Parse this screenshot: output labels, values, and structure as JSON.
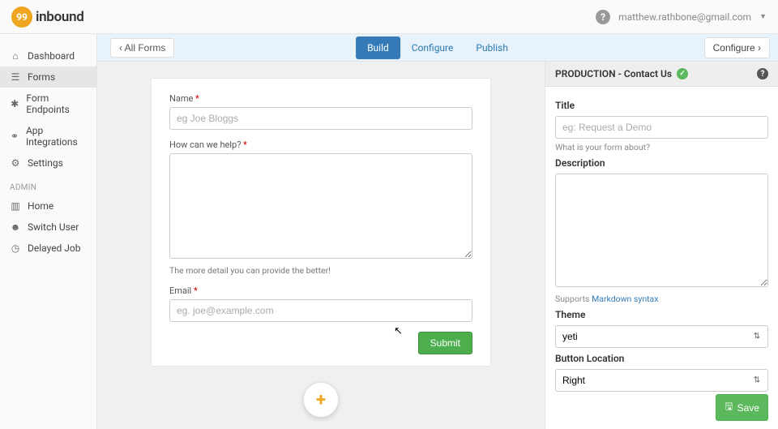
{
  "brand": {
    "badge": "99",
    "name": "inbound"
  },
  "user": {
    "email": "matthew.rathbone@gmail.com"
  },
  "sidebar": {
    "items": [
      {
        "icon": "home",
        "label": "Dashboard"
      },
      {
        "icon": "list",
        "label": "Forms"
      },
      {
        "icon": "code",
        "label": "Form Endpoints"
      },
      {
        "icon": "plug",
        "label": "App Integrations"
      },
      {
        "icon": "gear",
        "label": "Settings"
      }
    ],
    "admin_heading": "ADMIN",
    "admin_items": [
      {
        "icon": "chart",
        "label": "Home"
      },
      {
        "icon": "user",
        "label": "Switch User"
      },
      {
        "icon": "clock",
        "label": "Delayed Job"
      }
    ]
  },
  "tabbar": {
    "all_forms": "All Forms",
    "tabs": [
      "Build",
      "Configure",
      "Publish"
    ],
    "configure_btn": "Configure"
  },
  "form": {
    "fields": [
      {
        "label": "Name",
        "required": true,
        "placeholder": "eg Joe Bloggs",
        "type": "text"
      },
      {
        "label": "How can we help?",
        "required": true,
        "placeholder": "",
        "type": "textarea",
        "help": "The more detail you can provide the better!"
      },
      {
        "label": "Email",
        "required": true,
        "placeholder": "eg. joe@example.com",
        "type": "text"
      }
    ],
    "submit": "Submit"
  },
  "sidepanel": {
    "env_label": "PRODUCTION - Contact Us",
    "title_label": "Title",
    "title_placeholder": "eg: Request a Demo",
    "title_help": "What is your form about?",
    "desc_label": "Description",
    "desc_help_prefix": "Supports ",
    "desc_help_link": "Markdown syntax",
    "theme_label": "Theme",
    "theme_value": "yeti",
    "button_loc_label": "Button Location",
    "button_loc_value": "Right",
    "save": "Save"
  }
}
